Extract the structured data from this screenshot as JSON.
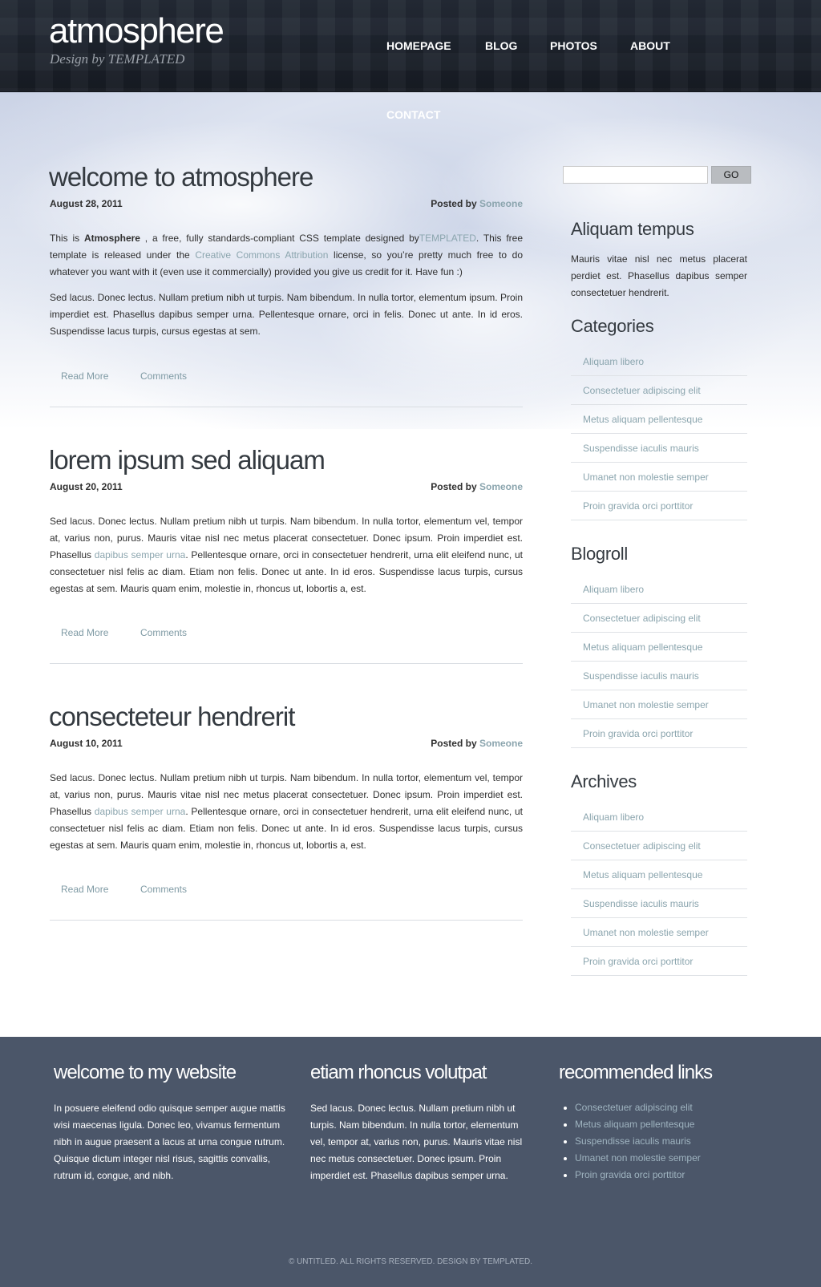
{
  "header": {
    "site_title": "atmosphere",
    "site_subtitle": "Design by TEMPLATED",
    "nav": [
      "HOMEPAGE",
      "BLOG",
      "PHOTOS",
      "ABOUT",
      "CONTACT"
    ]
  },
  "posts": [
    {
      "title": "welcome to atmosphere",
      "date": "August 28, 2011",
      "posted_by_label": "Posted by",
      "author": "Someone",
      "p1": {
        "a": "This is ",
        "b": "Atmosphere",
        "c": " , a free, fully standards-compliant CSS template designed by",
        "d": "TEMPLATED",
        "e": ". This free template is released under the ",
        "f": "Creative Commons Attribution",
        "g": " license, so you’re pretty much free to do whatever you want with it (even use it commercially) provided you give us credit for it. Have fun :)"
      },
      "p2": "Sed lacus. Donec lectus. Nullam pretium nibh ut turpis. Nam bibendum. In nulla tortor, elementum ipsum. Proin imperdiet est. Phasellus dapibus semper urna. Pellentesque ornare, orci in felis. Donec ut ante. In id eros. Suspendisse lacus turpis, cursus egestas at sem.",
      "read_more": "Read More",
      "comments": "Comments"
    },
    {
      "title": "lorem ipsum sed aliquam",
      "date": "August 20, 2011",
      "posted_by_label": "Posted by",
      "author": "Someone",
      "body": {
        "a": "Sed lacus. Donec lectus. Nullam pretium nibh ut turpis. Nam bibendum. In nulla tortor, elementum vel, tempor at, varius non, purus. Mauris vitae nisl nec metus placerat consectetuer. Donec ipsum. Proin imperdiet est. Phasellus ",
        "b": "dapibus semper urna",
        "c": ". Pellentesque ornare, orci in consectetuer hendrerit, urna elit eleifend nunc, ut consectetuer nisl felis ac diam. Etiam non felis. Donec ut ante. In id eros. Suspendisse lacus turpis, cursus egestas at sem. Mauris quam enim, molestie in, rhoncus ut, lobortis a, est."
      },
      "read_more": "Read More",
      "comments": "Comments"
    },
    {
      "title": "consecteteur hendrerit",
      "date": "August 10, 2011",
      "posted_by_label": "Posted by",
      "author": "Someone",
      "body": {
        "a": "Sed lacus. Donec lectus. Nullam pretium nibh ut turpis. Nam bibendum. In nulla tortor, elementum vel, tempor at, varius non, purus. Mauris vitae nisl nec metus placerat consectetuer. Donec ipsum. Proin imperdiet est. Phasellus ",
        "b": "dapibus semper urna",
        "c": ". Pellentesque ornare, orci in consectetuer hendrerit, urna elit eleifend nunc, ut consectetuer nisl felis ac diam. Etiam non felis. Donec ut ante. In id eros. Suspendisse lacus turpis, cursus egestas at sem. Mauris quam enim, molestie in, rhoncus ut, lobortis a, est."
      },
      "read_more": "Read More",
      "comments": "Comments"
    }
  ],
  "sidebar": {
    "search_button": "GO",
    "about_title": "Aliquam tempus",
    "about_text": "Mauris vitae nisl nec metus placerat perdiet est. Phasellus dapibus semper consectetuer hendrerit.",
    "categories_title": "Categories",
    "categories": [
      "Aliquam libero",
      "Consectetuer adipiscing elit",
      "Metus aliquam pellentesque",
      "Suspendisse iaculis mauris",
      "Umanet non molestie semper",
      "Proin gravida orci porttitor"
    ],
    "blogroll_title": "Blogroll",
    "blogroll": [
      "Aliquam libero",
      "Consectetuer adipiscing elit",
      "Metus aliquam pellentesque",
      "Suspendisse iaculis mauris",
      "Umanet non molestie semper",
      "Proin gravida orci porttitor"
    ],
    "archives_title": "Archives",
    "archives": [
      "Aliquam libero",
      "Consectetuer adipiscing elit",
      "Metus aliquam pellentesque",
      "Suspendisse iaculis mauris",
      "Umanet non molestie semper",
      "Proin gravida orci porttitor"
    ]
  },
  "footer": {
    "col1_title": "welcome to my website",
    "col1_text": "In posuere eleifend odio quisque semper augue mattis wisi maecenas ligula. Donec leo, vivamus fermentum nibh in augue praesent a lacus at urna congue rutrum. Quisque dictum integer nisl risus, sagittis convallis, rutrum id, congue, and nibh.",
    "col2_title": "etiam rhoncus volutpat",
    "col2_text": "Sed lacus. Donec lectus. Nullam pretium nibh ut turpis. Nam bibendum. In nulla tortor, elementum vel, tempor at, varius non, purus. Mauris vitae nisl nec metus consectetuer. Donec ipsum. Proin imperdiet est. Phasellus dapibus semper urna.",
    "col3_title": "recommended links",
    "links": [
      "Consectetuer adipiscing elit",
      "Metus aliquam pellentesque",
      "Suspendisse iaculis mauris",
      "Umanet non molestie semper",
      "Proin gravida orci porttitor"
    ],
    "copyright": "© Untitled. All rights reserved. Design by  TEMPLATED."
  },
  "colors": {
    "header_bg": "#1f2530",
    "link": "#8ba5ae",
    "footer_bg": "#4b5669"
  }
}
